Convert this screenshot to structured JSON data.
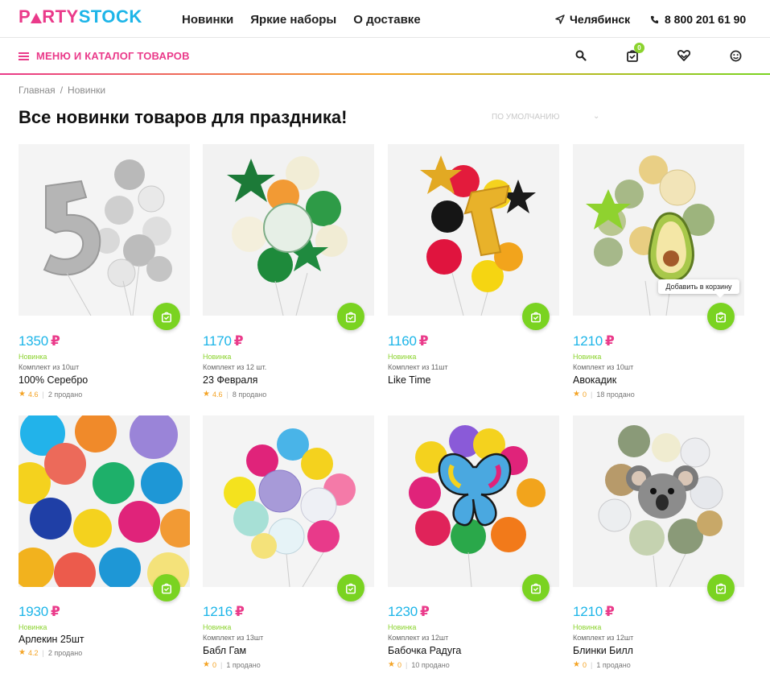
{
  "header": {
    "logo_a": "P",
    "logo_b": "RTY",
    "logo_c": "STOCK",
    "nav": [
      "Новинки",
      "Яркие наборы",
      "О доставке"
    ],
    "city": "Челябинск",
    "phone": "8 800 201 61 90"
  },
  "menubar": {
    "menu_label": "Меню и каталог товаров",
    "cart_count": "0"
  },
  "breadcrumb": [
    "Главная",
    "/",
    "Новинки"
  ],
  "page_title": "Все новинки товаров для праздника!",
  "sort_label": "по умолчанию",
  "tooltip": "Добавить в корзину",
  "currency": "₽",
  "products": [
    {
      "price": "1350",
      "tag": "Новинка",
      "set": "Комплект из 10шт",
      "name": "100% Серебро",
      "rating": "4.6",
      "sold": "2 продано"
    },
    {
      "price": "1170",
      "tag": "Новинка",
      "set": "Комплект из 12 шт.",
      "name": "23 Февраля",
      "rating": "4.6",
      "sold": "8 продано"
    },
    {
      "price": "1160",
      "tag": "Новинка",
      "set": "Комплект из 11шт",
      "name": "Like Time",
      "rating": "",
      "sold": ""
    },
    {
      "price": "1210",
      "tag": "Новинка",
      "set": "Комплект из 10шт",
      "name": "Авокадик",
      "rating": "0",
      "sold": "18 продано"
    },
    {
      "price": "1930",
      "tag": "Новинка",
      "set": "",
      "name": "Арлекин 25шт",
      "rating": "4.2",
      "sold": "2 продано"
    },
    {
      "price": "1216",
      "tag": "Новинка",
      "set": "Комплект из 13шт",
      "name": "Бабл Гам",
      "rating": "0",
      "sold": "1 продано"
    },
    {
      "price": "1230",
      "tag": "Новинка",
      "set": "Комплект из 12шт",
      "name": "Бабочка Радуга",
      "rating": "0",
      "sold": "10 продано"
    },
    {
      "price": "1210",
      "tag": "Новинка",
      "set": "Комплект из 12шт",
      "name": "Блинки Билл",
      "rating": "0",
      "sold": "1 продано"
    }
  ],
  "colors": {
    "brand_pink": "#ea3a8a",
    "brand_blue": "#1db5e8",
    "brand_green": "#7ad321",
    "brand_orange": "#f4a324"
  }
}
